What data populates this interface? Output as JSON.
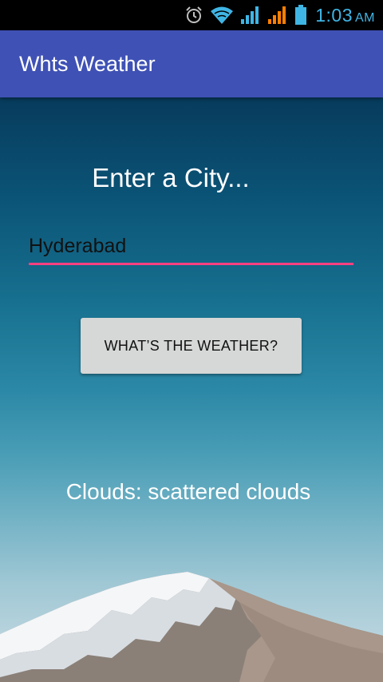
{
  "status_bar": {
    "time": "1:03",
    "ampm": "AM",
    "icons": [
      "alarm-icon",
      "wifi-icon",
      "signal-icon",
      "signal-warning-icon",
      "battery-icon"
    ]
  },
  "app_bar": {
    "title": "Whts Weather",
    "color": "#3f51b5"
  },
  "main": {
    "heading": "Enter a City...",
    "city_input": {
      "value": "Hyderabad",
      "placeholder": ""
    },
    "weather_button": {
      "label": "WHAT’S THE WEATHER?"
    },
    "result_text": "Clouds: scattered clouds"
  },
  "colors": {
    "accent": "#ff4081",
    "status_icon": "#3fb5e5",
    "warning": "#ff7f00"
  }
}
